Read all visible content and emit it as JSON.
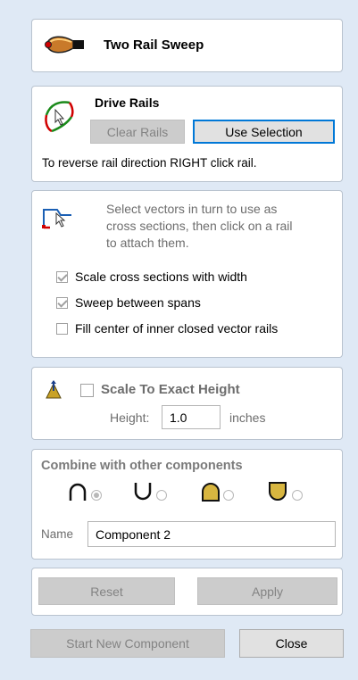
{
  "header": {
    "title": "Two Rail Sweep"
  },
  "drive_rails": {
    "title": "Drive Rails",
    "clear_label": "Clear Rails",
    "use_selection_label": "Use Selection",
    "hint": "To reverse rail direction RIGHT click rail."
  },
  "cross_sections": {
    "instructions": [
      "Select vectors in turn to use as",
      "cross sections, then click on a rail",
      "to attach them."
    ],
    "options": [
      {
        "label": "Scale cross sections with width",
        "checked": true
      },
      {
        "label": "Sweep between spans",
        "checked": true
      },
      {
        "label": "Fill center of inner closed vector rails",
        "checked": false
      }
    ]
  },
  "scale": {
    "label": "Scale To Exact Height",
    "checked": false,
    "height_label": "Height:",
    "height_value": "1.0",
    "unit": "inches"
  },
  "combine": {
    "title": "Combine with other components",
    "modes": [
      {
        "icon": "arch-outline-icon",
        "selected": true
      },
      {
        "icon": "u-outline-icon",
        "selected": false
      },
      {
        "icon": "arch-filled-icon",
        "selected": false
      },
      {
        "icon": "u-filled-icon",
        "selected": false
      }
    ],
    "name_label": "Name",
    "name_value": "Component 2"
  },
  "actions": {
    "reset_label": "Reset",
    "apply_label": "Apply"
  },
  "footer": {
    "start_label": "Start New Component",
    "close_label": "Close"
  }
}
